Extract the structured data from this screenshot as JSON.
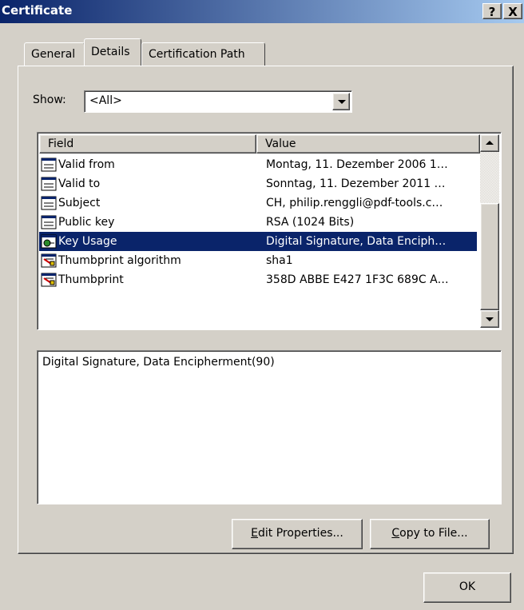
{
  "window": {
    "title": "Certificate",
    "help_label": "?",
    "close_label": "X"
  },
  "tabs": [
    {
      "label": "General"
    },
    {
      "label": "Details"
    },
    {
      "label": "Certification Path"
    }
  ],
  "show": {
    "label": "Show:",
    "selected": "<All>"
  },
  "fields_table": {
    "headers": {
      "field": "Field",
      "value": "Value"
    },
    "rows": [
      {
        "field": "Valid from",
        "value": "Montag, 11. Dezember 2006 1…",
        "icon": "field-icon"
      },
      {
        "field": "Valid to",
        "value": "Sonntag, 11. Dezember 2011 …",
        "icon": "field-icon"
      },
      {
        "field": "Subject",
        "value": "CH, philip.renggli@pdf-tools.c…",
        "icon": "field-icon"
      },
      {
        "field": "Public key",
        "value": "RSA (1024 Bits)",
        "icon": "field-icon"
      },
      {
        "field": "Key Usage",
        "value": "Digital Signature, Data Enciph…",
        "icon": "extension-icon",
        "selected": true
      },
      {
        "field": "Thumbprint algorithm",
        "value": "sha1",
        "icon": "property-icon"
      },
      {
        "field": "Thumbprint",
        "value": "358D ABBE E427 1F3C 689C A…",
        "icon": "property-icon"
      }
    ]
  },
  "detail_text": "Digital Signature, Data Encipherment(90)",
  "buttons": {
    "edit_properties": {
      "prefix": "",
      "accel": "E",
      "rest": "dit Properties..."
    },
    "copy_to_file": {
      "prefix": "",
      "accel": "C",
      "rest": "opy to File..."
    },
    "ok": "OK"
  },
  "colors": {
    "selection": "#0a246a",
    "dialog_bg": "#d4d0c8",
    "title_gradient_start": "#0a246a",
    "title_gradient_end": "#a6caf0"
  }
}
